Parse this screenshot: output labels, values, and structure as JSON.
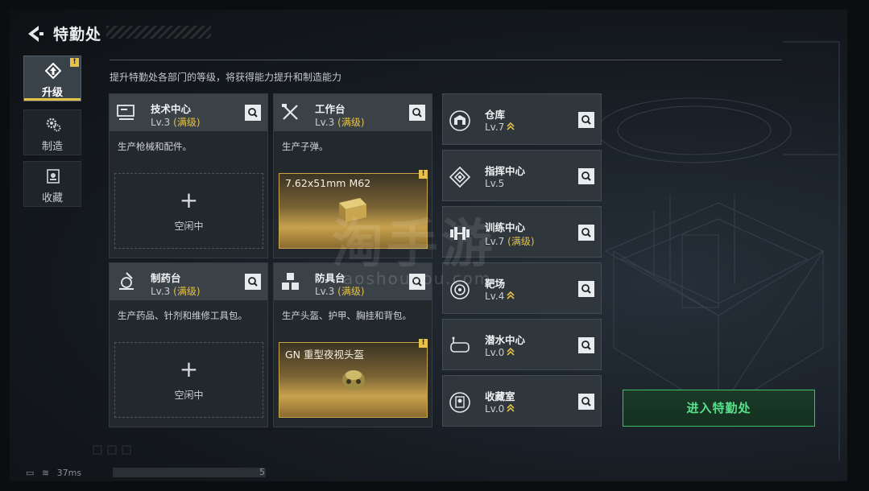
{
  "header": {
    "title": "特勤处"
  },
  "tabs": [
    {
      "label": "升级",
      "active": true,
      "badge": "!"
    },
    {
      "label": "制造",
      "active": false
    },
    {
      "label": "收藏",
      "active": false
    }
  ],
  "description": "提升特勤处各部门的等级，将获得能力提升和制造能力",
  "cards": [
    {
      "name": "技术中心",
      "level": "Lv.3",
      "max_label": "(满级)",
      "desc": "生产枪械和配件。",
      "idle_label": "空闲中"
    },
    {
      "name": "工作台",
      "level": "Lv.3",
      "max_label": "(满级)",
      "desc": "生产子弹。",
      "product": "7.62x51mm M62",
      "badge": "!"
    },
    {
      "name": "制药台",
      "level": "Lv.3",
      "max_label": "(满级)",
      "desc": "生产药品、针剂和维修工具包。",
      "idle_label": "空闲中"
    },
    {
      "name": "防具台",
      "level": "Lv.3",
      "max_label": "(满级)",
      "desc": "生产头盔、护甲、胸挂和背包。",
      "product": "GN 重型夜视头盔",
      "badge": "!"
    }
  ],
  "facilities": [
    {
      "name": "仓库",
      "level": "Lv.7",
      "max_label": "",
      "upgradable": true
    },
    {
      "name": "指挥中心",
      "level": "Lv.5",
      "max_label": "",
      "upgradable": false
    },
    {
      "name": "训练中心",
      "level": "Lv.7",
      "max_label": "(满级)",
      "upgradable": false
    },
    {
      "name": "靶场",
      "level": "Lv.4",
      "max_label": "",
      "upgradable": true
    },
    {
      "name": "潜水中心",
      "level": "Lv.0",
      "max_label": "",
      "upgradable": true
    },
    {
      "name": "收藏室",
      "level": "Lv.0",
      "max_label": "",
      "upgradable": true
    }
  ],
  "enter_button": "进入特勤处",
  "watermark": {
    "main": "淘手游",
    "sub": "aoshouyou.com"
  },
  "status": {
    "ping": "37ms",
    "count": "5"
  },
  "colors": {
    "accent_gold": "#e5c24a",
    "enter_green": "#58e08a"
  }
}
